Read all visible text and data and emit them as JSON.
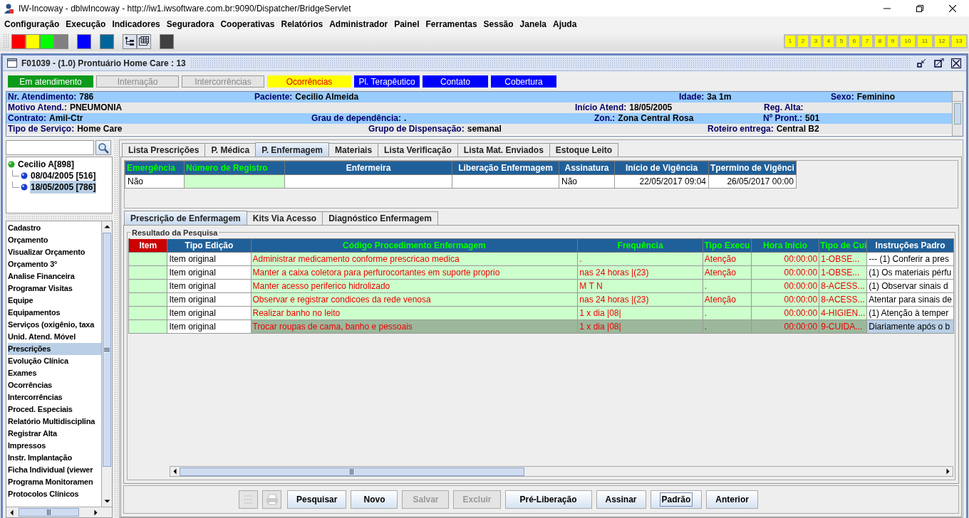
{
  "window": {
    "title": "IW-Incoway - dblwIncoway - http://iw1.iwsoftware.com.br:9090/Dispatcher/BridgeServlet"
  },
  "menu": [
    "Configuração",
    "Execução",
    "Indicadores",
    "Seguradora",
    "Cooperativas",
    "Relatórios",
    "Administrador",
    "Painel",
    "Ferramentas",
    "Sessão",
    "Janela",
    "Ajuda"
  ],
  "toolbar": {
    "groups": [
      [
        {
          "kind": "swatch",
          "color": "#ff0000"
        },
        {
          "kind": "swatch",
          "color": "#ffff00"
        },
        {
          "kind": "swatch",
          "color": "#00ff00"
        },
        {
          "kind": "swatch",
          "color": "#808080"
        }
      ],
      [
        {
          "kind": "swatch",
          "color": "#0000ff"
        }
      ],
      [
        {
          "kind": "swatch",
          "color": "#006699"
        }
      ],
      [
        {
          "kind": "tree"
        },
        {
          "kind": "grid"
        }
      ],
      [
        {
          "kind": "swatch",
          "color": "#404040"
        }
      ]
    ],
    "numbers": [
      "1",
      "2",
      "3",
      "4",
      "5",
      "6",
      "7",
      "8",
      "9",
      "10",
      "11",
      "12",
      "13"
    ]
  },
  "frame": {
    "title": "F01039 - (1.0) Prontuário Home Care : 13"
  },
  "status_buttons": [
    {
      "label": "Em atendimento",
      "kind": "current"
    },
    {
      "label": "Internação",
      "kind": "inactive"
    },
    {
      "label": "Intercorrências",
      "kind": "inactive"
    },
    {
      "label": "Ocorrências",
      "kind": "alert"
    },
    {
      "label": "Pl. Terapêutico",
      "kind": "info"
    },
    {
      "label": "Contato",
      "kind": "info"
    },
    {
      "label": "Cobertura",
      "kind": "info"
    }
  ],
  "info_rows": [
    [
      {
        "label": "Nr. Atendimento:",
        "value": "786"
      },
      {
        "label": "Paciente:",
        "value": "Cecilio Almeida"
      },
      {
        "label": "Idade:",
        "value": "3a 1m"
      },
      {
        "label": "Sexo:",
        "value": "Feminino"
      }
    ],
    [
      {
        "label": "Motivo Atend.:",
        "value": "PNEUMONIA"
      },
      {
        "label": "Início Atend:",
        "value": "18/05/2005"
      },
      {
        "label": "Reg. Alta:"
      }
    ],
    [
      {
        "label": "Contrato:",
        "value": "Amil-Ctr"
      },
      {
        "label": "Grau de dependência:",
        "value": "."
      },
      {
        "label": "Zon.:",
        "value": "Zona Central Rosa"
      },
      {
        "label": "Nº Pront.:",
        "value": "501"
      }
    ],
    [
      {
        "label": "Tipo de Serviço:",
        "value": "Home Care"
      },
      {
        "label": "Grupo de Dispensação:",
        "value": "semanal"
      },
      {
        "label": "Roteiro entrega:",
        "value": "Central B2"
      }
    ]
  ],
  "tree": [
    {
      "label": "Cecilio A[898]",
      "selected": false,
      "children": [
        {
          "label": "08/04/2005 [516]",
          "selected": false
        },
        {
          "label": "18/05/2005 [786]",
          "selected": true
        }
      ]
    }
  ],
  "nav_items": [
    {
      "label": "Cadastro",
      "selected": false
    },
    {
      "label": "Orçamento",
      "selected": false
    },
    {
      "label": "Visualizar Orçamento",
      "selected": false
    },
    {
      "label": "Orçamento 3°",
      "selected": false
    },
    {
      "label": "Analise Financeira",
      "selected": false
    },
    {
      "label": "Programar Visitas",
      "selected": false
    },
    {
      "label": "Equipe",
      "selected": false
    },
    {
      "label": "Equipamentos",
      "selected": false
    },
    {
      "label": "Serviços (oxigênio, taxa",
      "selected": false
    },
    {
      "label": "Unid. Atend. Móvel",
      "selected": false
    },
    {
      "label": "Prescrições",
      "selected": true
    },
    {
      "label": "Evolução Clínica",
      "selected": false
    },
    {
      "label": "Exames",
      "selected": false
    },
    {
      "label": "Ocorrências",
      "selected": false
    },
    {
      "label": "Intercorrências",
      "selected": false
    },
    {
      "label": "Proced. Especiais",
      "selected": false
    },
    {
      "label": "Relatório Multidisciplina",
      "selected": false
    },
    {
      "label": "Registrar Alta",
      "selected": false
    },
    {
      "label": "Impressos",
      "selected": false
    },
    {
      "label": "Instr. Implantação",
      "selected": false
    },
    {
      "label": "Ficha Individual (viewer",
      "selected": false
    },
    {
      "label": "Programa Monitoramen",
      "selected": false
    },
    {
      "label": "Protocolos Clínicos",
      "selected": false
    }
  ],
  "tabs": [
    {
      "label": "Lista Prescrições",
      "selected": false
    },
    {
      "label": "P. Médica",
      "selected": false
    },
    {
      "label": "P. Enfermagem",
      "selected": true
    },
    {
      "label": "Materiais",
      "selected": false
    },
    {
      "label": "Lista Verificação",
      "selected": false
    },
    {
      "label": "Lista Mat. Enviados",
      "selected": false
    },
    {
      "label": "Estoque Leito",
      "selected": false
    }
  ],
  "registry_table": {
    "columns": [
      {
        "label": "Emergência",
        "highlighted": true,
        "value": "Não"
      },
      {
        "label": "Número de Registro",
        "highlighted": true
      },
      {
        "label": "Enfermeira",
        "highlighted": false
      },
      {
        "label": "Liberação Enfermagem",
        "highlighted": false
      },
      {
        "label": "Assinatura",
        "highlighted": false,
        "value": "Não"
      },
      {
        "label": "Início de Vigência",
        "highlighted": false,
        "value": "22/05/2017 09:04"
      },
      {
        "label": "Tpermino de Vigênci",
        "highlighted": false,
        "value": "26/05/2017 00:00"
      }
    ]
  },
  "sub_tabs": [
    {
      "label": "Prescrição de Enfermagem",
      "selected": true
    },
    {
      "label": "Kits Via Acesso",
      "selected": false
    },
    {
      "label": "Diagnóstico Enfermagem",
      "selected": false
    }
  ],
  "results": {
    "title": "Resultado da Pesquisa",
    "columns": [
      {
        "label": "Item",
        "highlighted": false
      },
      {
        "label": "Tipo Edição",
        "highlighted": false
      },
      {
        "label": "Código Procedimento Enfermagem",
        "highlighted": true
      },
      {
        "label": "Frequência",
        "highlighted": true
      },
      {
        "label": "Tipo Execu",
        "highlighted": true
      },
      {
        "label": "Hora Início",
        "highlighted": true
      },
      {
        "label": "Tipo de Cui",
        "highlighted": true
      },
      {
        "label": "Instruções Padro",
        "highlighted": false
      }
    ],
    "rows": [
      {
        "selected": false,
        "cells": [
          "",
          "Item original",
          "Administrar medicamento conforme prescricao medica",
          ".",
          "Atenção",
          "00:00:00",
          "1-OBSE...",
          "--- (1) Conferir a pres"
        ]
      },
      {
        "selected": false,
        "cells": [
          "",
          "Item original",
          "Manter a caixa coletora para perfurocortantes em suporte proprio",
          "nas 24 horas |(23)",
          "Atenção",
          "00:00:00",
          "1-OBSE...",
          "(1) Os materiais pérfu"
        ]
      },
      {
        "selected": false,
        "cells": [
          "",
          "Item original",
          "Manter acesso periferico hidrolizado",
          "M T N",
          ".",
          "00:00:00",
          "8-ACESS...",
          "(1) Observar sinais d"
        ]
      },
      {
        "selected": false,
        "cells": [
          "",
          "Item original",
          "Observar e registrar condicoes da rede venosa",
          "nas 24 horas |(23)",
          "Atenção",
          "00:00:00",
          "8-ACESS...",
          "Atentar para sinais de"
        ]
      },
      {
        "selected": false,
        "cells": [
          "",
          "Item original",
          "Realizar banho no leito",
          "1 x dia |08|",
          ".",
          "00:00:00",
          "4-HIGIEN...",
          "(1) Atenção à temper"
        ]
      },
      {
        "selected": true,
        "cells": [
          "",
          "Item original",
          "Trocar roupas de cama, banho e pessoais",
          "1 x dia |08|",
          ".",
          "00:00:00",
          "9-CUIDA...",
          "Diariamente após o b"
        ]
      }
    ]
  },
  "buttons": [
    {
      "kind": "list",
      "disabled": true
    },
    {
      "kind": "printer",
      "disabled": true
    },
    {
      "kind": "text",
      "label": "Pesquisar",
      "disabled": false,
      "focused": false
    },
    {
      "kind": "text",
      "label": "Novo",
      "disabled": false,
      "focused": false
    },
    {
      "kind": "text",
      "label": "Salvar",
      "disabled": true,
      "focused": false
    },
    {
      "kind": "text",
      "label": "Excluir",
      "disabled": true,
      "focused": false
    },
    {
      "kind": "text",
      "label": "Pré-Liberação",
      "disabled": false,
      "focused": false
    },
    {
      "kind": "text",
      "label": "Assinar",
      "disabled": false,
      "focused": false
    },
    {
      "kind": "text",
      "label": "Padrão",
      "disabled": false,
      "focused": true
    },
    {
      "kind": "text",
      "label": "Anterior",
      "disabled": false,
      "focused": false
    }
  ]
}
